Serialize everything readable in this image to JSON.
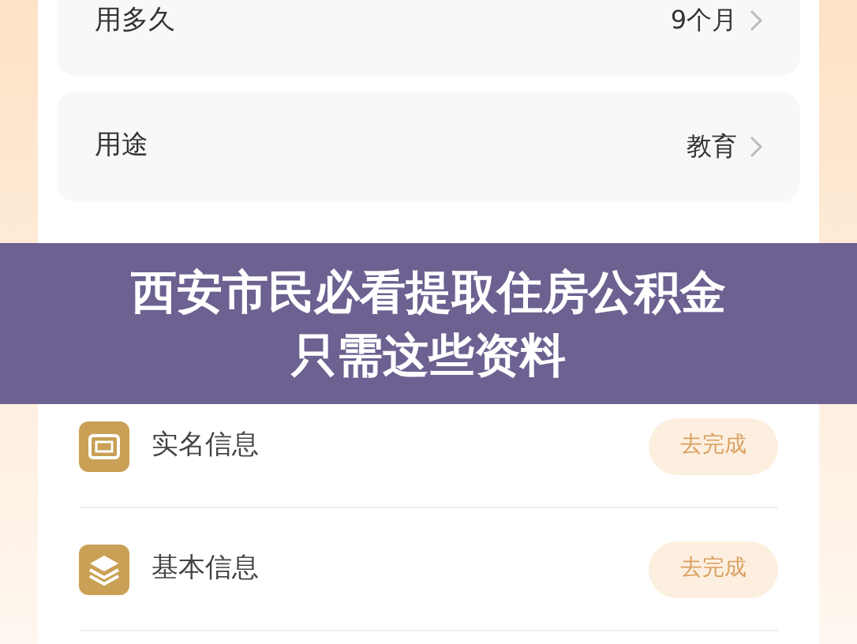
{
  "settings": [
    {
      "label": "用多久",
      "value": "9个月"
    },
    {
      "label": "用途",
      "value": "教育"
    }
  ],
  "banner": {
    "title": "西安市民必看提取住房公积金只需这些资料"
  },
  "tasks": [
    {
      "kind": "id-card",
      "label": "实名信息",
      "action": "去完成"
    },
    {
      "kind": "layers",
      "label": "基本信息",
      "action": "去完成"
    }
  ]
}
